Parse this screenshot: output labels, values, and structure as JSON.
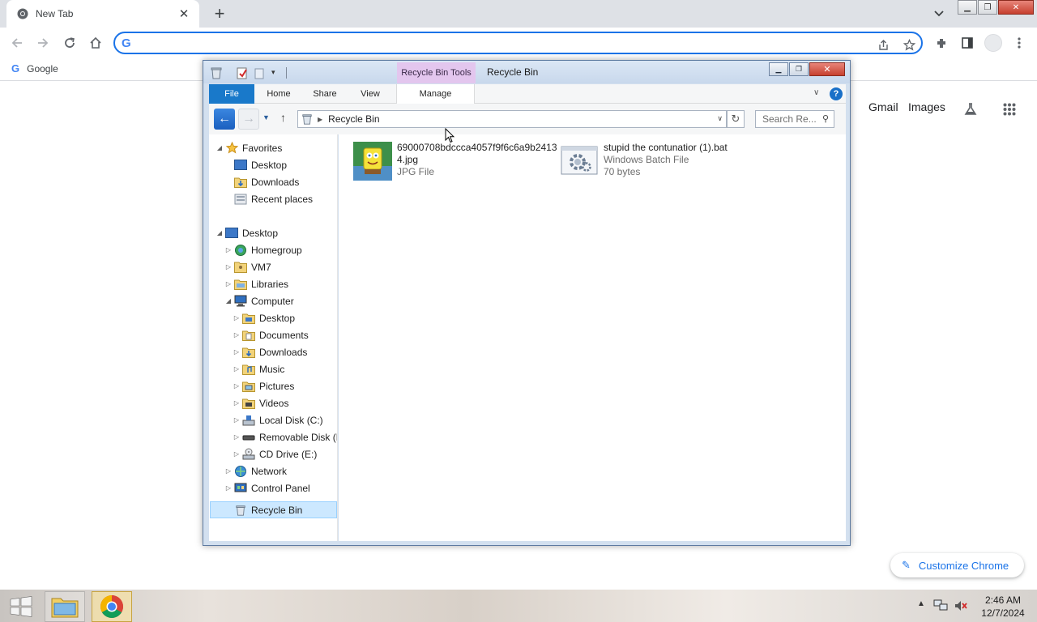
{
  "chrome": {
    "tab_title": "New Tab",
    "omnibox_placeholder": "",
    "bookmark_label": "Google",
    "links": {
      "gmail": "Gmail",
      "images": "Images"
    },
    "customize_label": "Customize Chrome",
    "accent_color": "#1a73e8"
  },
  "explorer": {
    "contextual_tab": "Recycle Bin Tools",
    "window_title": "Recycle Bin",
    "ribbon_tabs": {
      "file": "File",
      "home": "Home",
      "share": "Share",
      "view": "View",
      "manage": "Manage"
    },
    "address_crumb": "Recycle Bin",
    "search_placeholder": "Search Re...",
    "nav_tree": {
      "favorites": "Favorites",
      "fav_desktop": "Desktop",
      "fav_downloads": "Downloads",
      "fav_recent": "Recent places",
      "desktop": "Desktop",
      "homegroup": "Homegroup",
      "vm7": "VM7",
      "libraries": "Libraries",
      "computer": "Computer",
      "comp_desktop": "Desktop",
      "comp_documents": "Documents",
      "comp_downloads": "Downloads",
      "comp_music": "Music",
      "comp_pictures": "Pictures",
      "comp_videos": "Videos",
      "local_disk": "Local Disk (C:)",
      "removable_disk": "Removable Disk (D",
      "cd_drive": "CD Drive (E:)",
      "network": "Network",
      "control_panel": "Control Panel",
      "recycle_bin": "Recycle Bin"
    },
    "files": [
      {
        "name_line1": "69000708bdccca4057f9f6c6a9b2413",
        "name_line2": "4.jpg",
        "type": "JPG File",
        "size": ""
      },
      {
        "name_line1": "stupid the contunatior (1).bat",
        "name_line2": "",
        "type": "Windows Batch File",
        "size": "70 bytes"
      }
    ]
  },
  "taskbar": {
    "time": "2:46 AM",
    "date": "12/7/2024"
  }
}
